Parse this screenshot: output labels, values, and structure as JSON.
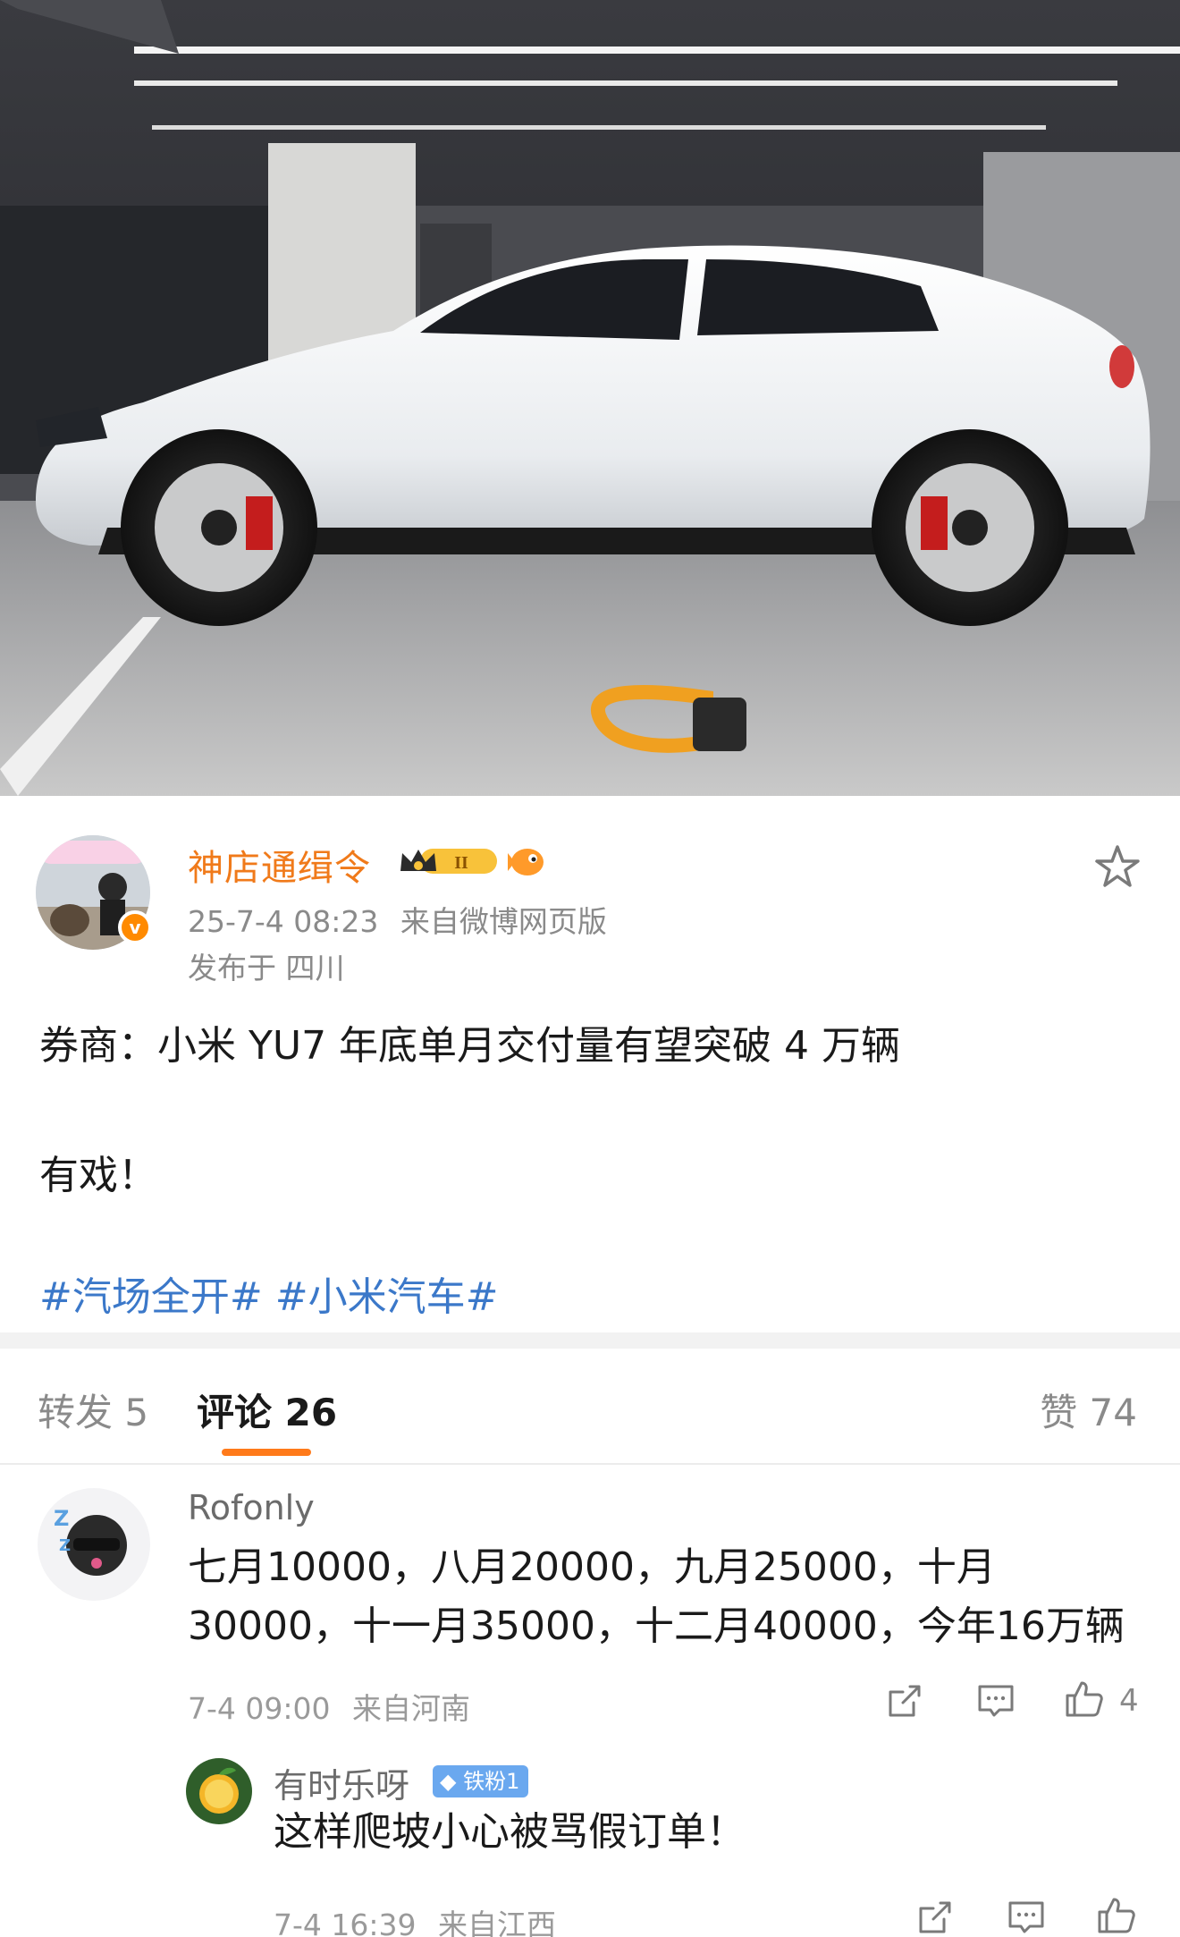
{
  "post": {
    "username": "神店通缉令",
    "time": "25-7-4 08:23",
    "source": "来自微博网页版",
    "location": "发布于 四川",
    "body": "券商：小米 YU7 年底单月交付量有望突破 4 万辆",
    "body2": "有戏！",
    "hashtags": [
      "#汽场全开#",
      "#小米汽车#"
    ],
    "level_badge": "II"
  },
  "tabs": {
    "repost": "转发 5",
    "comment": "评论 26",
    "like": "赞 74"
  },
  "comments": [
    {
      "name": "Rofonly",
      "text_line1": "七月10000，八月20000，九月25000，十月",
      "text_line2": "30000，十一月35000，十二月40000，今年16万辆",
      "time": "7-4 09:00",
      "location": "来自河南",
      "likes": "4"
    },
    {
      "name": "有时乐呀",
      "badge": "铁粉1",
      "text": "这样爬坡小心被骂假订单！",
      "time": "7-4 16:39",
      "location": "来自江西"
    }
  ],
  "icons": {
    "star": "star-icon",
    "share": "share-icon",
    "comment": "comment-icon",
    "like": "thumbs-up-icon"
  },
  "colors": {
    "username": "#f07a1a",
    "hashtag": "#3b78c9",
    "tab_indicator": "#ff7a1a",
    "fan_badge": "#6aa8ef"
  }
}
